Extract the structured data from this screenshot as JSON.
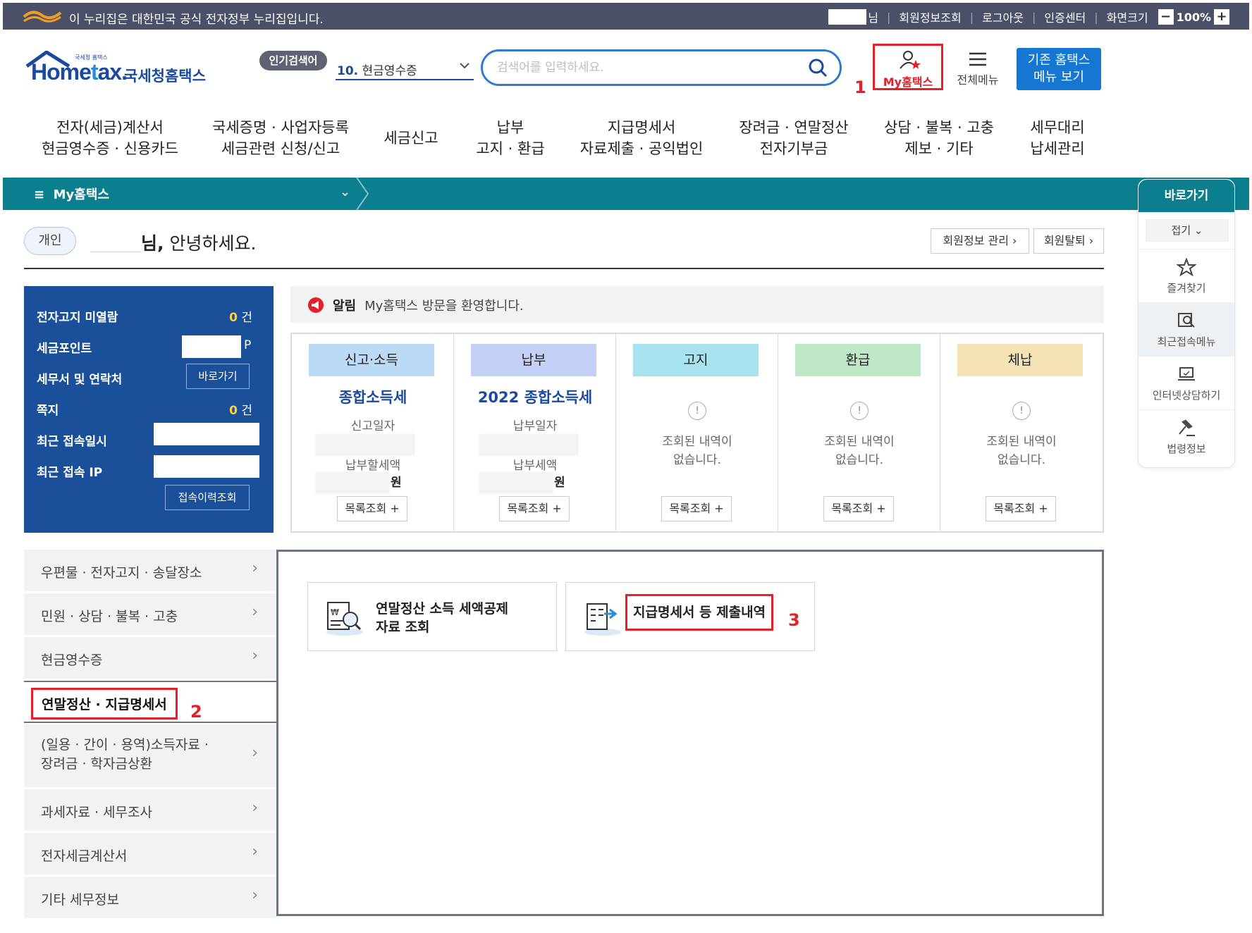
{
  "gov_bar": {
    "notice": "이 누리집은 대한민국 공식 전자정부 누리집입니다.",
    "name_suffix": "님",
    "member_info": "회원정보조회",
    "logout": "로그아웃",
    "cert_center": "인증센터",
    "screen_size": "화면크기",
    "zoom_out": "−",
    "zoom": "100%",
    "zoom_in": "+"
  },
  "header": {
    "logo_small": "국세청 홈택스",
    "logo_brand_pre": "Home",
    "logo_brand_e": "t",
    "logo_brand_post": "ax.",
    "logo_kor": "국세청홈택스",
    "popular_label": "인기검색어",
    "popular_num": "10.",
    "popular_value": "현금영수증",
    "search_placeholder": "검색어를 입력하세요.",
    "myhometax": "My홈택스",
    "all_menu": "전체메뉴",
    "old_menu_line1": "기존 홈택스",
    "old_menu_line2": "메뉴 보기"
  },
  "markers": {
    "m1": "1",
    "m2": "2",
    "m3": "3"
  },
  "gnb": [
    {
      "l1": "전자(세금)계산서",
      "l2": "현금영수증 · 신용카드"
    },
    {
      "l1": "국세증명 · 사업자등록",
      "l2": "세금관련 신청/신고"
    },
    {
      "l1": "세금신고",
      "l2": ""
    },
    {
      "l1": "납부",
      "l2": "고지 · 환급"
    },
    {
      "l1": "지급명세서",
      "l2": "자료제출 · 공익법인"
    },
    {
      "l1": "장려금 · 연말정산",
      "l2": "전자기부금"
    },
    {
      "l1": "상담 · 불복 · 고충",
      "l2": "제보 · 기타"
    },
    {
      "l1": "세무대리",
      "l2": "납세관리"
    }
  ],
  "teal_bar": {
    "menu_icon": "≡",
    "label": "My홈택스",
    "chevron": "⌄"
  },
  "quick": {
    "title": "바로가기",
    "fold": "접기 ⌄",
    "items": [
      "즐겨찾기",
      "최근접속메뉴",
      "인터넷상담하기",
      "법령정보"
    ]
  },
  "greeting": {
    "type": "개인",
    "suffix": "님,",
    "text": "안녕하세요.",
    "manage_btn": "회원정보 관리 ›",
    "withdraw_btn": "회원탈퇴 ›"
  },
  "info": {
    "rows": [
      "전자고지 미열람",
      "세금포인트",
      "세무서 및 연락처",
      "쪽지",
      "최근 접속일시",
      "최근 접속 IP"
    ],
    "unread_count": "0",
    "unit_count": "건",
    "point_unit": "P",
    "office_btn": "바로가기",
    "note_count": "0",
    "history_btn": "접속이력조회"
  },
  "notice": {
    "label": "알림",
    "text": "My홈택스 방문을 환영합니다."
  },
  "cards": [
    {
      "head": "신고·소득",
      "color": "#bcd9f6",
      "title": "종합소득세",
      "sub1": "신고일자",
      "sub2": "납부할세액",
      "won": "원",
      "more": "목록조회 +"
    },
    {
      "head": "납부",
      "color": "#c4d0f5",
      "title": "2022 종합소득세",
      "sub1": "납부일자",
      "sub2": "납부세액",
      "won": "원",
      "more": "목록조회 +"
    },
    {
      "head": "고지",
      "color": "#a9e2ef",
      "excl": "!",
      "none1": "조회된 내역이",
      "none2": "없습니다.",
      "more": "목록조회 +"
    },
    {
      "head": "환급",
      "color": "#bfe8c9",
      "excl": "!",
      "none1": "조회된 내역이",
      "none2": "없습니다.",
      "more": "목록조회 +"
    },
    {
      "head": "체납",
      "color": "#f4e3b4",
      "excl": "!",
      "none1": "조회된 내역이",
      "none2": "없습니다.",
      "more": "목록조회 +"
    }
  ],
  "left_menu": [
    {
      "label": "우편물 · 전자고지 · 송달장소",
      "arrow": "›"
    },
    {
      "label": "민원 · 상담 · 불복 · 고충",
      "arrow": "›"
    },
    {
      "label": "현금영수증",
      "arrow": "›"
    },
    {
      "label": "연말정산 · 지급명세서",
      "arrow": ""
    },
    {
      "label": "(일용 · 간이 · 용역)소득자료 ·",
      "label2": "장려금 · 학자금상환",
      "arrow": "›"
    },
    {
      "label": "과세자료 · 세무조사",
      "arrow": "›"
    },
    {
      "label": "전자세금계산서",
      "arrow": "›"
    },
    {
      "label": "기타 세무정보",
      "arrow": "›"
    }
  ],
  "tiles": [
    {
      "l1": "연말정산 소득 세액공제",
      "l2": "자료 조회"
    },
    {
      "l1": "지급명세서 등 제출내역"
    }
  ],
  "colors": {
    "teal": "#0c7f8f",
    "navy": "#1a4f9a",
    "red_highlight": "#e5202a",
    "brand_blue": "#1677d2"
  }
}
